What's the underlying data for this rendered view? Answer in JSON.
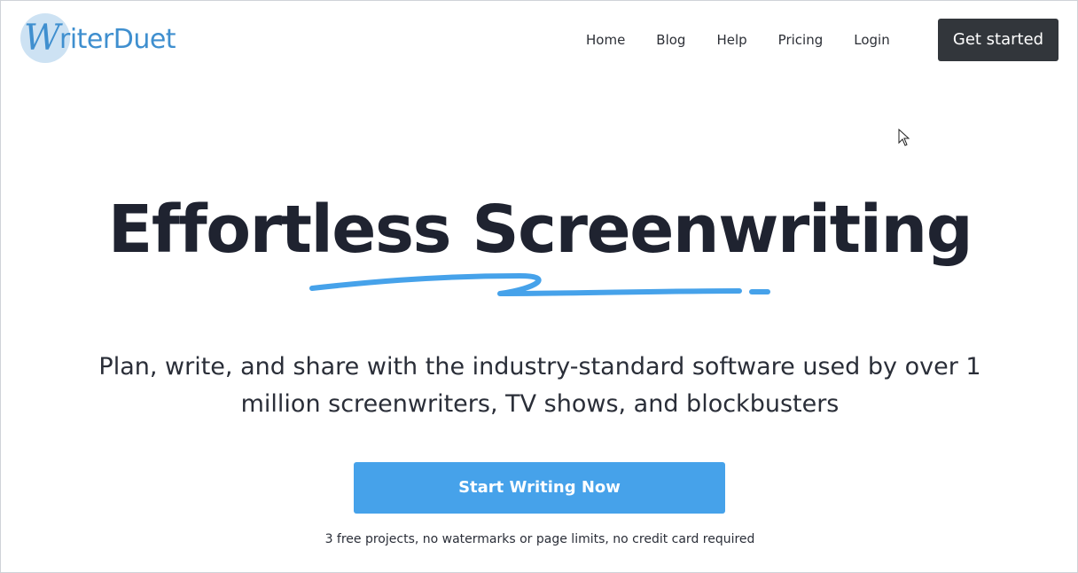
{
  "header": {
    "logo": {
      "letter": "W",
      "text": "riterDuet",
      "icon": "writerduet-logo"
    },
    "nav": [
      {
        "label": "Home"
      },
      {
        "label": "Blog"
      },
      {
        "label": "Help"
      },
      {
        "label": "Pricing"
      },
      {
        "label": "Login"
      }
    ],
    "cta_label": "Get started"
  },
  "hero": {
    "title": "Effortless Screenwriting",
    "subtitle": "Plan, write, and share with the industry-standard software used by over 1 million screenwriters, TV shows, and blockbusters",
    "cta_label": "Start Writing Now",
    "note": "3 free projects, no watermarks or page limits, no credit card required"
  },
  "colors": {
    "brand_blue": "#3f8fcf",
    "cta_blue": "#46a2ea",
    "dark_button": "#32363b",
    "title_text": "#1f2330"
  }
}
